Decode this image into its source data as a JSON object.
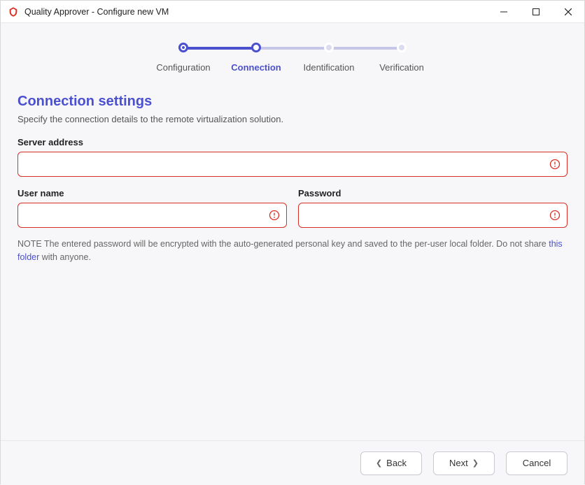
{
  "window": {
    "title": "Quality Approver - Configure new VM"
  },
  "stepper": {
    "steps": [
      {
        "label": "Configuration",
        "state": "done"
      },
      {
        "label": "Connection",
        "state": "active"
      },
      {
        "label": "Identification",
        "state": "todo"
      },
      {
        "label": "Verification",
        "state": "todo"
      }
    ]
  },
  "section": {
    "title": "Connection settings",
    "subtitle": "Specify the connection details to the remote virtualization solution."
  },
  "fields": {
    "server": {
      "label": "Server address",
      "value": "",
      "error": true
    },
    "username": {
      "label": "User name",
      "value": "",
      "error": true
    },
    "password": {
      "label": "Password",
      "value": "",
      "error": true
    }
  },
  "note": {
    "prefix": "NOTE The entered password will be encrypted with the auto-generated personal key and saved to the per-user local folder. Do not share ",
    "link": "this folder",
    "suffix": " with anyone."
  },
  "footer": {
    "back": "Back",
    "next": "Next",
    "cancel": "Cancel"
  }
}
